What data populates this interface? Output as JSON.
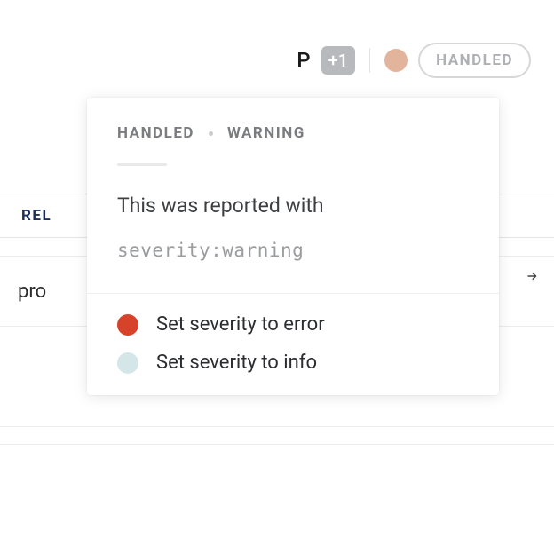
{
  "header": {
    "letter": "P",
    "count_badge": "+1",
    "status_dot_color": "#e3b49c",
    "handled_pill": "HANDLED"
  },
  "background": {
    "tab_label_fragment": "REL",
    "row_text_fragment": "pro"
  },
  "popover": {
    "tag_handled": "HANDLED",
    "tag_severity": "WARNING",
    "message": "This was reported with",
    "code": "severity:warning",
    "actions": [
      {
        "label": "Set severity to error",
        "color": "#d6432a",
        "kind": "error"
      },
      {
        "label": "Set severity to info",
        "color": "#d5e6e9",
        "kind": "info"
      }
    ]
  }
}
